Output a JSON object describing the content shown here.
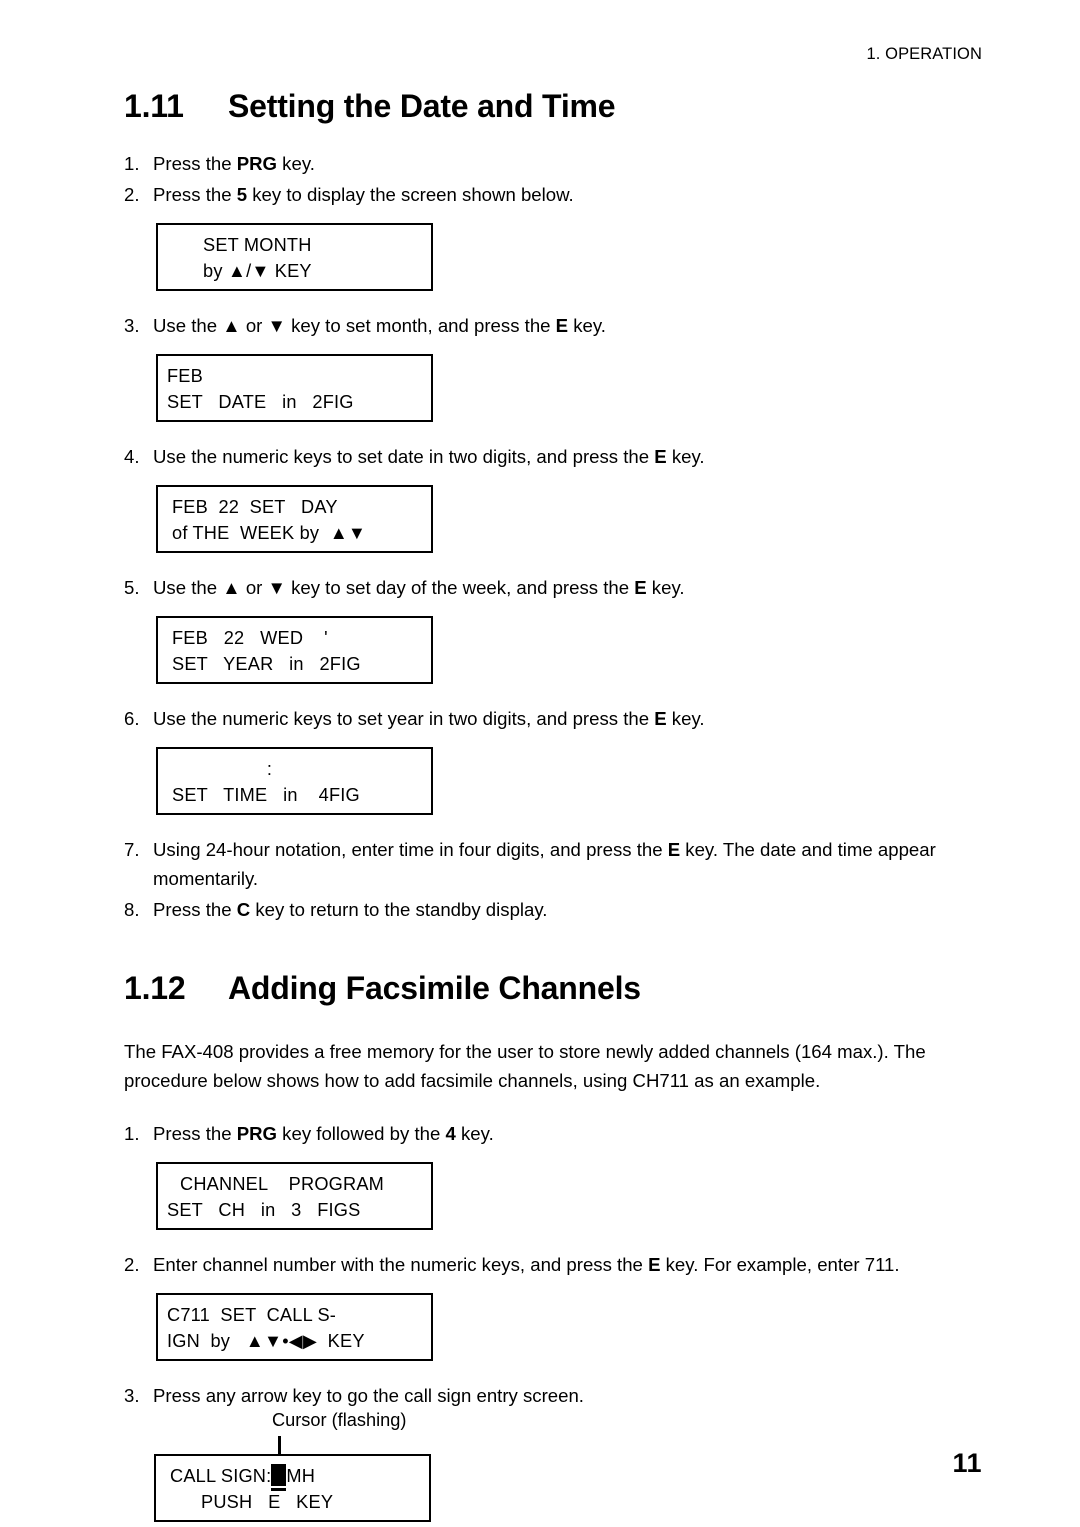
{
  "running_head": "1. OPERATION",
  "folio": "11",
  "sections": [
    {
      "number": "1.11",
      "title": "Setting the Date and Time",
      "steps": [
        {
          "marker": "1.",
          "parts": [
            {
              "t": "Press the "
            },
            {
              "t": "PRG",
              "b": true
            },
            {
              "t": " key."
            }
          ]
        },
        {
          "marker": "2.",
          "parts": [
            {
              "t": "Press the "
            },
            {
              "t": "5",
              "b": true
            },
            {
              "t": " key to display the screen shown below."
            }
          ]
        },
        {
          "marker": "3.",
          "parts": [
            {
              "t": "Use the ▲ or ▼ key to set month, and press the "
            },
            {
              "t": "E",
              "b": true
            },
            {
              "t": " key."
            }
          ]
        },
        {
          "marker": "4.",
          "parts": [
            {
              "t": "Use the numeric keys to set date in two digits, and press the "
            },
            {
              "t": "E",
              "b": true
            },
            {
              "t": " key."
            }
          ]
        },
        {
          "marker": "5.",
          "parts": [
            {
              "t": "Use the ▲ or ▼ key to set day of the week, and press the "
            },
            {
              "t": "E",
              "b": true
            },
            {
              "t": " key."
            }
          ]
        },
        {
          "marker": "6.",
          "parts": [
            {
              "t": "Use the numeric keys to set year in two digits, and press the "
            },
            {
              "t": "E",
              "b": true
            },
            {
              "t": " key."
            }
          ]
        },
        {
          "marker": "7.",
          "parts": [
            {
              "t": "Using 24-hour notation, enter time in four digits, and press the "
            },
            {
              "t": "E",
              "b": true
            },
            {
              "t": " key. The date and time appear momentarily."
            }
          ]
        },
        {
          "marker": "8.",
          "parts": [
            {
              "t": "Press the "
            },
            {
              "t": "C",
              "b": true
            },
            {
              "t": " key to return to the standby display."
            }
          ]
        }
      ]
    },
    {
      "number": "1.12",
      "title": "Adding Facsimile Channels",
      "paragraph": "The FAX-408 provides a free memory for the user to store newly added channels (164 max.). The procedure below shows how to add facsimile channels, using CH711 as an example.",
      "steps": [
        {
          "marker": "1.",
          "parts": [
            {
              "t": "Press the "
            },
            {
              "t": "PRG",
              "b": true
            },
            {
              "t": " key followed by the "
            },
            {
              "t": "4",
              "b": true
            },
            {
              "t": " key."
            }
          ]
        },
        {
          "marker": "2.",
          "parts": [
            {
              "t": "Enter channel number with the numeric keys, and press the "
            },
            {
              "t": "E",
              "b": true
            },
            {
              "t": " key. For example, enter 711."
            }
          ]
        },
        {
          "marker": "3.",
          "parts": [
            {
              "t": "Press any arrow key to go the call sign entry screen."
            }
          ]
        }
      ]
    }
  ],
  "screens": {
    "set_month": {
      "line1": "SET MONTH",
      "line2": "by ▲/▼ KEY"
    },
    "set_date": {
      "line1": "FEB",
      "line2": "SET   DATE   in   2FIG"
    },
    "set_day": {
      "line1": "FEB  22  SET   DAY",
      "line2": "of THE  WEEK by  ▲▼"
    },
    "set_year": {
      "line1": "FEB   22   WED    '",
      "line2": "SET   YEAR   in   2FIG"
    },
    "set_time": {
      "line1": ":",
      "line2": "SET   TIME   in    4FIG"
    },
    "ch_program": {
      "line1": "CHANNEL    PROGRAM",
      "line2": "SET   CH   in   3   FIGS"
    },
    "ch_callsign": {
      "line1": "C711  SET  CALL S-",
      "line2": "IGN  by   ▲▼•◀▶  KEY"
    },
    "call_sign": {
      "line1_prefix": "CALL SIGN:",
      "line1_suffix": "MH",
      "line2": "PUSH   E   KEY"
    }
  },
  "callout": {
    "cursor_label": "Cursor (flashing)"
  }
}
